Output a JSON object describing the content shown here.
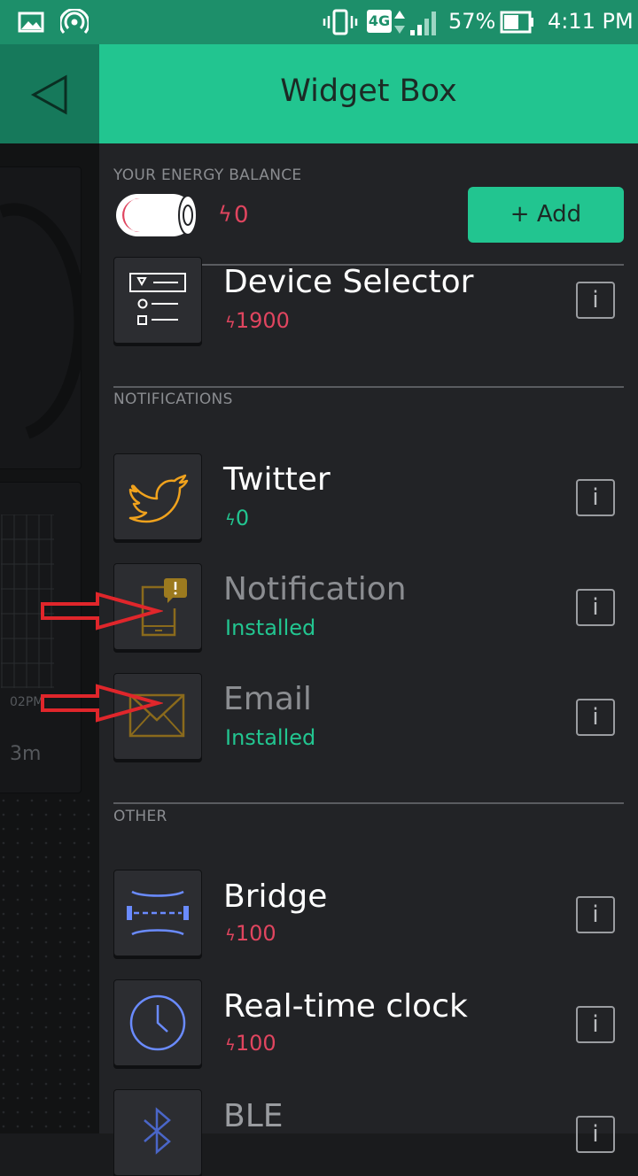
{
  "status_bar": {
    "network": "4G",
    "battery": "57%",
    "time": "4:11 PM"
  },
  "background": {
    "time_label": "02PM",
    "range_label": "3m"
  },
  "drawer": {
    "title": "Widget Box",
    "energy_label": "YOUR ENERGY BALANCE",
    "energy_value": "0",
    "add_label": "+ Add",
    "info_label": "i",
    "sections": [
      {
        "label": "NOTIFICATIONS"
      },
      {
        "label": "OTHER"
      }
    ],
    "items": [
      {
        "name": "Device Selector",
        "sub": "1900",
        "icon": "device-selector-icon"
      },
      {
        "name": "Twitter",
        "sub": "0",
        "icon": "twitter-bird-icon"
      },
      {
        "name": "Notification",
        "sub": "Installed",
        "icon": "notification-phone-icon"
      },
      {
        "name": "Email",
        "sub": "Installed",
        "icon": "envelope-icon"
      },
      {
        "name": "Bridge",
        "sub": "100",
        "icon": "bridge-icon"
      },
      {
        "name": "Real-time clock",
        "sub": "100",
        "icon": "clock-icon"
      },
      {
        "name": "BLE",
        "icon": "bluetooth-icon"
      }
    ]
  },
  "colors": {
    "accent": "#22c590",
    "price": "#e0455f",
    "drawer_bg": "#222326",
    "arrow": "#e0262b"
  }
}
